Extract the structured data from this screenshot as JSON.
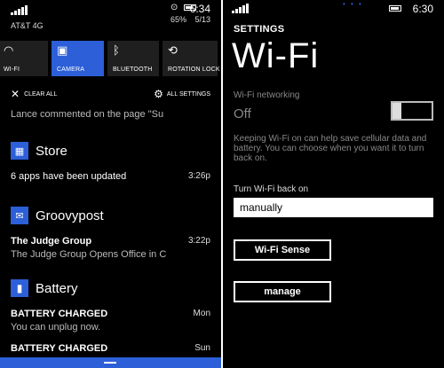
{
  "left_phone": {
    "status_bar": {
      "carrier": "AT&T 4G",
      "battery": "65%",
      "time": "6:34",
      "date": "5/13"
    },
    "quick_actions": [
      {
        "label": "WI-FI",
        "icon": "wifi-icon",
        "active": false
      },
      {
        "label": "CAMERA",
        "icon": "camera-icon",
        "active": true
      },
      {
        "label": "BLUETOOTH",
        "icon": "bluetooth-icon",
        "active": false
      },
      {
        "label": "ROTATION LOCK",
        "icon": "rotation-lock-icon",
        "active": false
      }
    ],
    "clear_all": "CLEAR ALL",
    "all_settings": "ALL SETTINGS",
    "truncated_notification": "Lance commented on the page \"Su",
    "groups": [
      {
        "app": "Store",
        "icon": "store-icon",
        "items": [
          {
            "title": "6 apps have been updated",
            "time": "3:26p",
            "body": ""
          }
        ]
      },
      {
        "app": "Groovypost",
        "icon": "mail-icon",
        "items": [
          {
            "title": "The Judge Group",
            "time": "3:22p",
            "body": "The Judge Group Opens Office in C"
          }
        ]
      },
      {
        "app": "Battery",
        "icon": "battery-icon",
        "items": [
          {
            "title": "BATTERY CHARGED",
            "time": "Mon",
            "body": "You can unplug now."
          },
          {
            "title": "BATTERY CHARGED",
            "time": "Sun",
            "body": ""
          }
        ]
      }
    ],
    "accent_color": "#2c5fd8"
  },
  "right_phone": {
    "status_bar": {
      "time": "6:30"
    },
    "section_label": "SETTINGS",
    "page_title": "Wi-Fi",
    "wifi_networking_label": "Wi-Fi networking",
    "wifi_state": "Off",
    "wifi_enabled": false,
    "description": "Keeping Wi-Fi on can help save cellular data and battery. You can choose when you want it to turn back on.",
    "turn_back_label": "Turn Wi-Fi back on",
    "turn_back_value": "manually",
    "wifi_sense_button": "Wi-Fi Sense",
    "manage_button": "manage"
  }
}
